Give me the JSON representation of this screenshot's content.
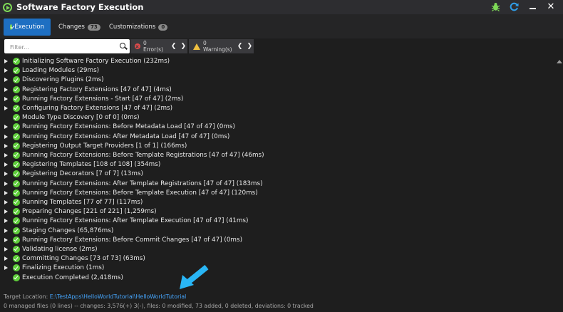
{
  "window": {
    "title": "Software Factory Execution",
    "icons": [
      "play-circle-icon",
      "bug-icon",
      "refresh-icon",
      "minimize-icon",
      "close-icon"
    ]
  },
  "tabs": [
    {
      "label": "Execution",
      "active": true
    },
    {
      "label": "Changes",
      "badge": "73"
    },
    {
      "label": "Customizations",
      "badge": "0"
    }
  ],
  "filter": {
    "placeholder": "Filter...",
    "errors_label": "0 Error(s)",
    "warnings_label": "0 Warning(s)"
  },
  "tree": [
    {
      "label": "Initializing Software Factory Execution (232ms)",
      "expandable": true
    },
    {
      "label": "Loading Modules (29ms)",
      "expandable": true
    },
    {
      "label": "Discovering Plugins (2ms)",
      "expandable": true
    },
    {
      "label": "Registering Factory Extensions [47 of 47] (4ms)",
      "expandable": true
    },
    {
      "label": "Running Factory Extensions - Start [47 of 47] (2ms)",
      "expandable": true
    },
    {
      "label": "Configuring Factory Extensions [47 of 47] (2ms)",
      "expandable": true
    },
    {
      "label": "Module Type Discovery [0 of 0] (0ms)",
      "expandable": false
    },
    {
      "label": "Running Factory Extensions: Before Metadata Load [47 of 47] (0ms)",
      "expandable": true
    },
    {
      "label": "Running Factory Extensions: After Metadata Load [47 of 47] (0ms)",
      "expandable": true
    },
    {
      "label": "Registering Output Target Providers [1 of 1] (166ms)",
      "expandable": true
    },
    {
      "label": "Running Factory Extensions: Before Template Registrations [47 of 47] (46ms)",
      "expandable": true
    },
    {
      "label": "Registering Templates [108 of 108] (354ms)",
      "expandable": true
    },
    {
      "label": "Registering Decorators [7 of 7] (13ms)",
      "expandable": true
    },
    {
      "label": "Running Factory Extensions: After Template Registrations [47 of 47] (183ms)",
      "expandable": true
    },
    {
      "label": "Running Factory Extensions: Before Template Execution [47 of 47] (120ms)",
      "expandable": true
    },
    {
      "label": "Running Templates [77 of 77] (117ms)",
      "expandable": true
    },
    {
      "label": "Preparing Changes [221 of 221] (1,259ms)",
      "expandable": true
    },
    {
      "label": "Running Factory Extensions: After Template Execution [47 of 47] (41ms)",
      "expandable": true
    },
    {
      "label": "Staging Changes (65,876ms)",
      "expandable": true
    },
    {
      "label": "Running Factory Extensions: Before Commit Changes [47 of 47] (0ms)",
      "expandable": true
    },
    {
      "label": "Validating license (2ms)",
      "expandable": true
    },
    {
      "label": "Committing Changes [73 of 73] (63ms)",
      "expandable": true
    },
    {
      "label": "Finalizing Execution (1ms)",
      "expandable": true
    },
    {
      "label": "Execution Completed (2,418ms)",
      "expandable": false
    }
  ],
  "footer": {
    "target_prefix": "Target Location: ",
    "target_path": "E:\\TestApps\\HelloWorldTutorial\\HelloWorldTutorial",
    "summary": "0 managed files (0 lines) -- changes: 3,576(+) 3(-), files: 0 modified, 73 added, 0 deleted, deviations: 0 tracked"
  },
  "colors": {
    "accent": "#1e6fc2",
    "success": "#5fce3b",
    "link": "#46a7ff",
    "annotation_arrow": "#29b6f6"
  }
}
